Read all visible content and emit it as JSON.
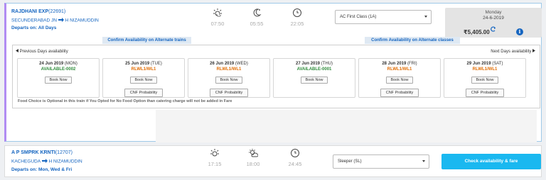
{
  "train1": {
    "name": "RAJDHANI EXP",
    "number": "(22691)",
    "from": "SECUNDERABAD JN",
    "to": "H NIZAMUDDIN",
    "departs_label": "Departs on:",
    "departs_value": "All Days",
    "times": [
      "07:50",
      "05:55",
      "22:05"
    ],
    "class_selected": "AC First Class (1A)",
    "fare": {
      "day": "Monday",
      "date": "24-6-2019",
      "price": "₹5,405.00"
    },
    "alt_trains_label": "Confirm Availability on Alternate trains",
    "alt_classes_label": "Confirm Availability on Alternate classes",
    "prev_label": "Previous Days availability",
    "next_label": "Next Days availability",
    "days": [
      {
        "date": "24 Jun 2019",
        "dow": "(MON)",
        "status": "AVAILABLE-0002",
        "status_color": "green",
        "book": "Book Now",
        "cnf": ""
      },
      {
        "date": "25 Jun 2019",
        "dow": "(TUE)",
        "status": "RLWL1/WL1",
        "status_color": "orange",
        "book": "Book Now",
        "cnf": "CNF Probability"
      },
      {
        "date": "26 Jun 2019",
        "dow": "(WED)",
        "status": "RLWL1/WL1",
        "status_color": "orange",
        "book": "Book Now",
        "cnf": "CNF Probability"
      },
      {
        "date": "27 Jun 2019",
        "dow": "(THU)",
        "status": "AVAILABLE-0001",
        "status_color": "green",
        "book": "Book Now",
        "cnf": ""
      },
      {
        "date": "28 Jun 2019",
        "dow": "(FRI)",
        "status": "RLWL1/WL1",
        "status_color": "orange",
        "book": "Book Now",
        "cnf": "CNF Probability"
      },
      {
        "date": "29 Jun 2019",
        "dow": "(SAT)",
        "status": "RLWL1/WL1",
        "status_color": "orange",
        "book": "Book Now",
        "cnf": "CNF Probability"
      }
    ],
    "food_note": "Food Choice is Optional in this train if You Opted for No Food Option than catering charge will not be added in Fare"
  },
  "train2": {
    "name": "A P SMPRK KRNTI",
    "number": "(12707)",
    "from": "KACHEGUDA",
    "to": "H NIZAMUDDIN",
    "departs_label": "Departs on:",
    "departs_value": "Mon, Wed & Fri",
    "times": [
      "17:15",
      "18:00",
      "24:45"
    ],
    "class_selected": "Sleeper (SL)",
    "check_label": "Check availability & fare"
  },
  "colors": {
    "accent_blue": "#1565c0",
    "check_button": "#1ab8f0",
    "available_green": "#2e8b3a",
    "waitlist_orange": "#e06b00",
    "card_left_border": "#b18cf2"
  }
}
